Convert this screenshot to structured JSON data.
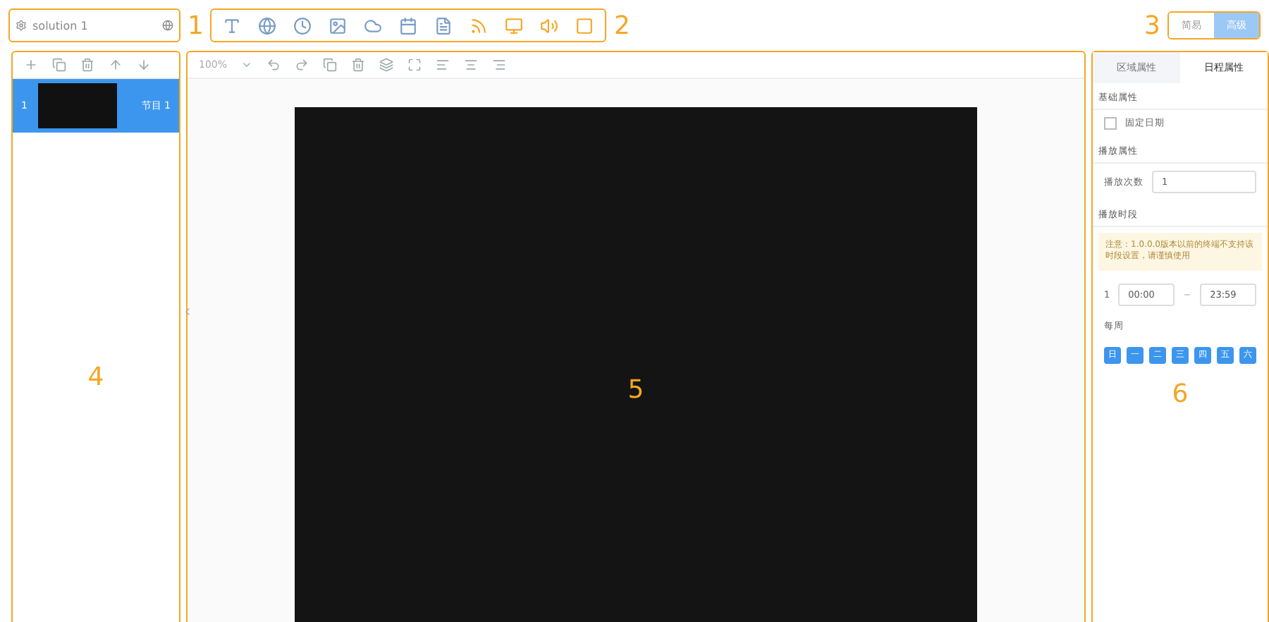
{
  "solution": {
    "name": "solution 1"
  },
  "callouts": [
    "1",
    "2",
    "3",
    "4",
    "5",
    "6"
  ],
  "mode_toggle": [
    {
      "label": "简易",
      "selected": false
    },
    {
      "label": "高级",
      "selected": true
    }
  ],
  "page_list": {
    "items": [
      {
        "index": "1",
        "label": "节目 1",
        "selected": true
      }
    ]
  },
  "canvas_toolbar": {
    "zoom": "100%"
  },
  "properties": {
    "tabs": [
      {
        "label": "区域属性",
        "selected": false
      },
      {
        "label": "日程属性",
        "selected": true
      }
    ],
    "sections": [
      {
        "title": "基础属性"
      },
      {
        "title": "播放属性"
      },
      {
        "title": "播放时段"
      }
    ],
    "fixed_play": {
      "label": "固定日期",
      "checked": false
    },
    "play_count": {
      "label": "播放次数",
      "value": "1"
    },
    "notice": "注意：1.0.0.0版本以前的终端不支持该时段设置，请谨慎使用",
    "period": {
      "index": "1",
      "start": "00:00",
      "end": "23:59"
    },
    "week_label": "每周",
    "days": [
      {
        "label": "日",
        "selected": true
      },
      {
        "label": "一",
        "selected": true
      },
      {
        "label": "二",
        "selected": true
      },
      {
        "label": "三",
        "selected": true
      },
      {
        "label": "四",
        "selected": true
      },
      {
        "label": "五",
        "selected": true
      },
      {
        "label": "六",
        "selected": true
      }
    ]
  }
}
